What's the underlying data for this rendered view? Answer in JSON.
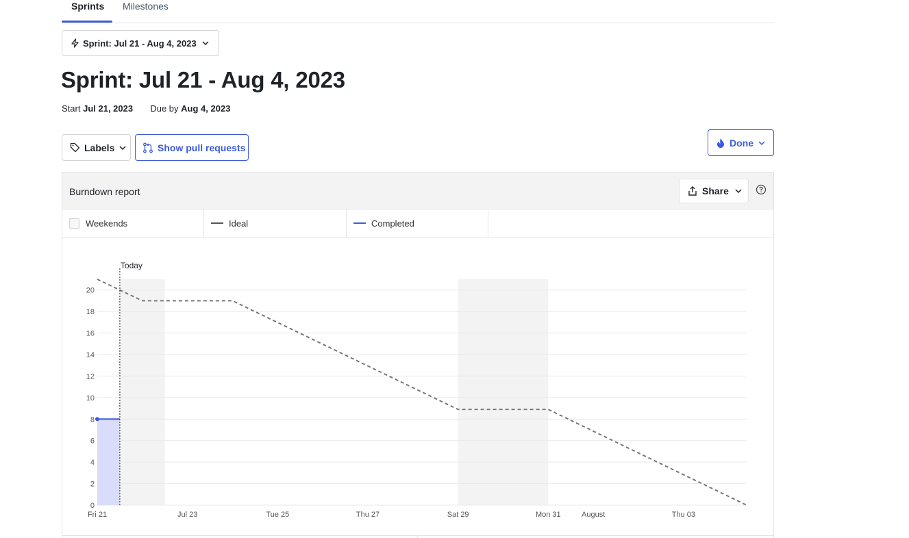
{
  "tabs": [
    {
      "label": "Sprints",
      "active": true
    },
    {
      "label": "Milestones",
      "active": false
    }
  ],
  "sprint_select": {
    "label": "Sprint: Jul 21 - Aug 4, 2023",
    "icon": "lightning-icon"
  },
  "page_title": "Sprint: Jul 21 - Aug 4, 2023",
  "dates": {
    "start_label": "Start",
    "start_value": "Jul 21, 2023",
    "due_label": "Due by",
    "due_value": "Aug 4, 2023"
  },
  "toolbar": {
    "labels_button": "Labels",
    "pull_requests_button": "Show pull requests",
    "done_button": "Done"
  },
  "report": {
    "title": "Burndown report",
    "share_button": "Share",
    "legend": {
      "weekends": "Weekends",
      "ideal": "Ideal",
      "completed": "Completed"
    }
  },
  "colors": {
    "accent": "#3b5bdb",
    "ideal_line": "#777777",
    "completed_line": "#3b5bdb",
    "completed_fill": "#d9ddfb",
    "weekend_band": "#f3f3f3"
  },
  "chart_data": {
    "type": "line",
    "today_label": "Today",
    "today_x": 0.5,
    "x_tick_labels": [
      {
        "x": 0,
        "label": "Fri 21"
      },
      {
        "x": 2,
        "label": "Jul 23"
      },
      {
        "x": 4,
        "label": "Tue 25"
      },
      {
        "x": 6,
        "label": "Thu 27"
      },
      {
        "x": 8,
        "label": "Sat 29"
      },
      {
        "x": 10,
        "label": "Mon 31"
      },
      {
        "x": 11,
        "label": "August"
      },
      {
        "x": 13,
        "label": "Thu 03"
      }
    ],
    "ylim": [
      0,
      21
    ],
    "xlim": [
      0,
      14.4
    ],
    "y_ticks": [
      0,
      2,
      4,
      6,
      8,
      10,
      12,
      14,
      16,
      18,
      20
    ],
    "weekend_bands": [
      [
        0.5,
        1.5
      ],
      [
        8,
        10
      ]
    ],
    "grid": true,
    "series": [
      {
        "name": "Ideal",
        "style": "dashed",
        "points": [
          [
            0,
            21
          ],
          [
            1,
            19
          ],
          [
            3,
            19
          ],
          [
            8,
            8.9
          ],
          [
            10,
            8.9
          ],
          [
            14.4,
            0
          ]
        ]
      },
      {
        "name": "Completed",
        "style": "solid-filled",
        "points": [
          [
            0,
            8
          ],
          [
            0.5,
            8
          ]
        ]
      }
    ]
  }
}
